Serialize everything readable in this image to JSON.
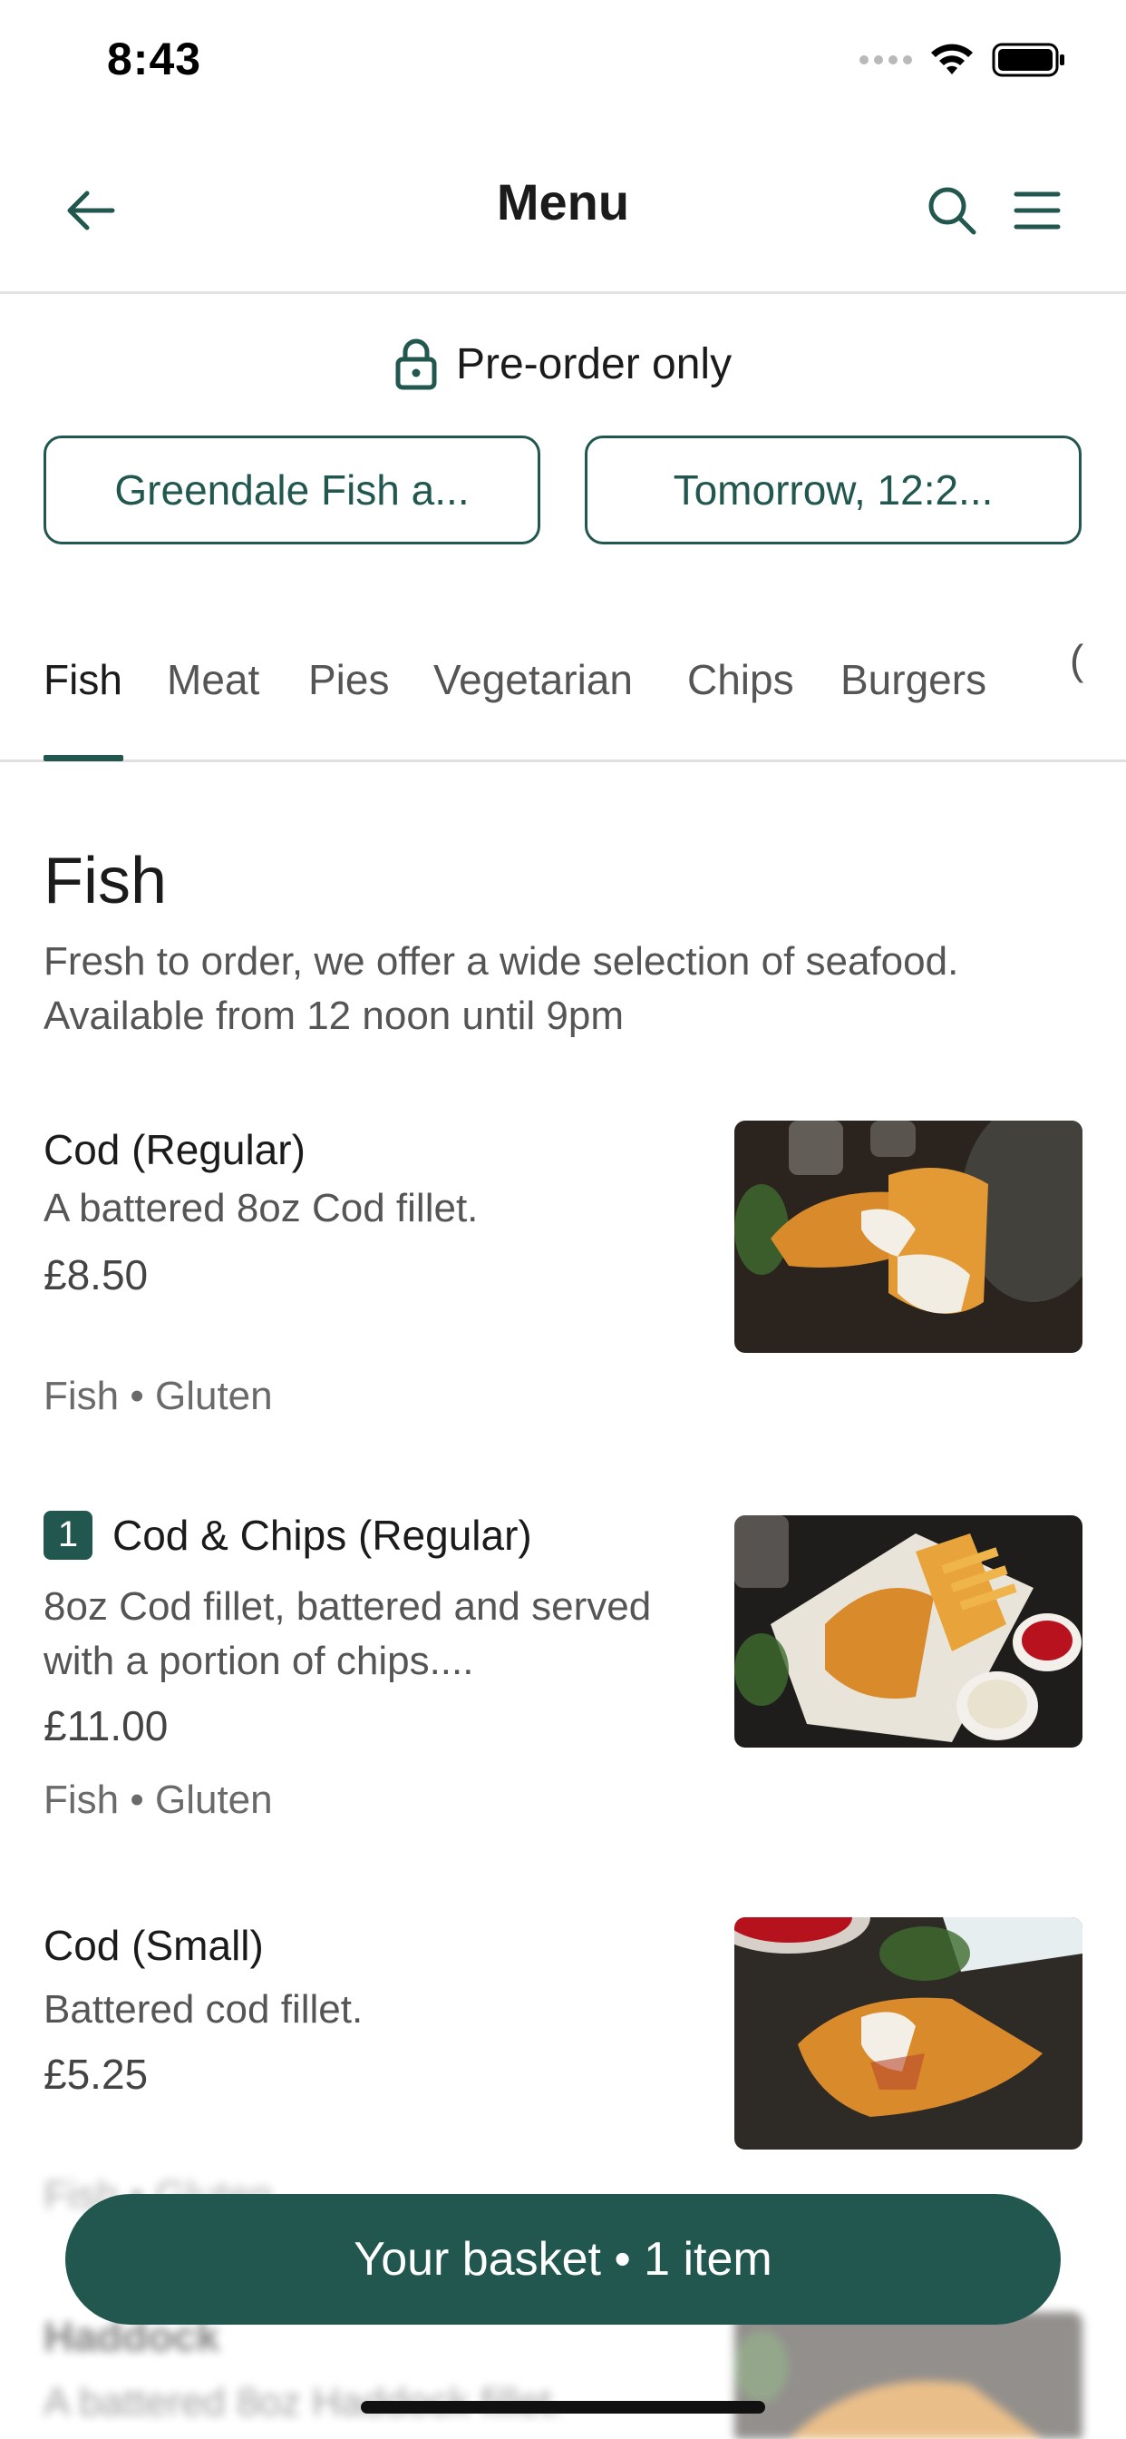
{
  "status_bar": {
    "time": "8:43"
  },
  "nav": {
    "title": "Menu"
  },
  "preorder": {
    "label": "Pre-order only"
  },
  "location_pill": {
    "label": "Greendale Fish a..."
  },
  "time_pill": {
    "label": "Tomorrow, 12:2..."
  },
  "tabs": [
    {
      "label": "Fish",
      "active": true
    },
    {
      "label": "Meat",
      "active": false
    },
    {
      "label": "Pies",
      "active": false
    },
    {
      "label": "Vegetarian",
      "active": false
    },
    {
      "label": "Chips",
      "active": false
    },
    {
      "label": "Burgers",
      "active": false
    },
    {
      "label": "(",
      "active": false
    }
  ],
  "section": {
    "title": "Fish",
    "description": "Fresh to order, we offer a wide selection of seafood. Available from 12 noon until 9pm"
  },
  "items": [
    {
      "name": "Cod (Regular)",
      "description": "A battered 8oz Cod fillet.",
      "price": "£8.50",
      "tags": "Fish • Gluten"
    },
    {
      "name": "Cod & Chips (Regular)",
      "quantity": "1",
      "description": "8oz Cod fillet, battered and served with a portion of chips....",
      "price": "£11.00",
      "tags": "Fish • Gluten"
    },
    {
      "name": "Cod (Small)",
      "description": "Battered cod fillet.",
      "price": "£5.25",
      "tags": "Fish • Gluten"
    },
    {
      "name": "Haddock",
      "description": "A battered 8oz Haddock fillet."
    }
  ],
  "basket": {
    "label": "Your basket • 1 item"
  },
  "colors": {
    "brand": "#22574f",
    "text": "#1b1b1b",
    "muted": "#555555"
  }
}
